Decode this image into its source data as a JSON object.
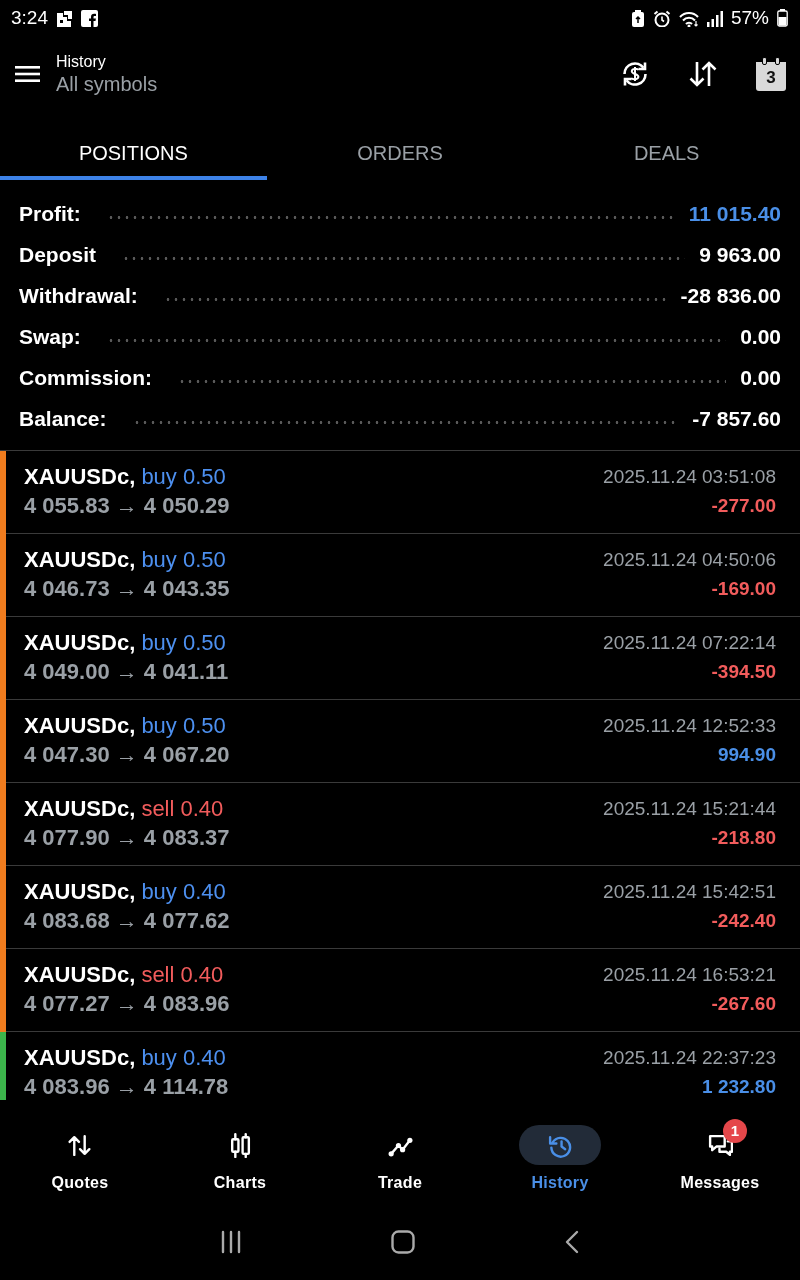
{
  "status_bar": {
    "time": "3:24",
    "battery": "57%"
  },
  "header": {
    "title": "History",
    "subtitle": "All symbols",
    "calendar_day": "3"
  },
  "tabs": [
    {
      "label": "POSITIONS",
      "selected": true
    },
    {
      "label": "ORDERS",
      "selected": false
    },
    {
      "label": "DEALS",
      "selected": false
    }
  ],
  "summary": [
    {
      "label": "Profit:",
      "value": "11 015.40",
      "accent": true
    },
    {
      "label": "Deposit",
      "value": "9 963.00",
      "accent": false
    },
    {
      "label": "Withdrawal:",
      "value": "-28 836.00",
      "accent": false
    },
    {
      "label": "Swap:",
      "value": "0.00",
      "accent": false
    },
    {
      "label": "Commission:",
      "value": "0.00",
      "accent": false
    },
    {
      "label": "Balance:",
      "value": "-7 857.60",
      "accent": false
    }
  ],
  "positions": [
    {
      "symbol": "XAUUSDc,",
      "trade": "buy 0.50",
      "kind": "buy",
      "prices": "4 055.83 → 4 050.29",
      "time": "2025.11.24 03:51:08",
      "profit": "-277.00",
      "loss": true,
      "color": "#f07c1e"
    },
    {
      "symbol": "XAUUSDc,",
      "trade": "buy 0.50",
      "kind": "buy",
      "prices": "4 046.73 → 4 043.35",
      "time": "2025.11.24 04:50:06",
      "profit": "-169.00",
      "loss": true,
      "color": "#f07c1e"
    },
    {
      "symbol": "XAUUSDc,",
      "trade": "buy 0.50",
      "kind": "buy",
      "prices": "4 049.00 → 4 041.11",
      "time": "2025.11.24 07:22:14",
      "profit": "-394.50",
      "loss": true,
      "color": "#f07c1e"
    },
    {
      "symbol": "XAUUSDc,",
      "trade": "buy 0.50",
      "kind": "buy",
      "prices": "4 047.30 → 4 067.20",
      "time": "2025.11.24 12:52:33",
      "profit": "994.90",
      "loss": false,
      "color": "#f07c1e"
    },
    {
      "symbol": "XAUUSDc,",
      "trade": "sell 0.40",
      "kind": "sell",
      "prices": "4 077.90 → 4 083.37",
      "time": "2025.11.24 15:21:44",
      "profit": "-218.80",
      "loss": true,
      "color": "#f07c1e"
    },
    {
      "symbol": "XAUUSDc,",
      "trade": "buy 0.40",
      "kind": "buy",
      "prices": "4 083.68 → 4 077.62",
      "time": "2025.11.24 15:42:51",
      "profit": "-242.40",
      "loss": true,
      "color": "#f07c1e"
    },
    {
      "symbol": "XAUUSDc,",
      "trade": "sell 0.40",
      "kind": "sell",
      "prices": "4 077.27 → 4 083.96",
      "time": "2025.11.24 16:53:21",
      "profit": "-267.60",
      "loss": true,
      "color": "#f07c1e"
    },
    {
      "symbol": "XAUUSDc,",
      "trade": "buy 0.40",
      "kind": "buy",
      "prices": "4 083.96 → 4 114.78",
      "time": "2025.11.24 22:37:23",
      "profit": "1 232.80",
      "loss": false,
      "color": "#3cb44b"
    }
  ],
  "bottom_nav": [
    {
      "label": "Quotes",
      "selected": false
    },
    {
      "label": "Charts",
      "selected": false
    },
    {
      "label": "Trade",
      "selected": false
    },
    {
      "label": "History",
      "selected": true
    },
    {
      "label": "Messages",
      "selected": false,
      "badge": "1"
    }
  ]
}
